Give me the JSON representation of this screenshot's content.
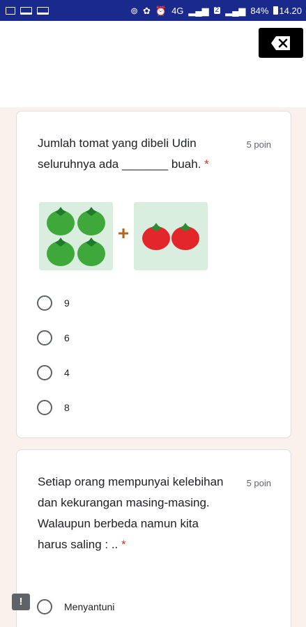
{
  "status_bar": {
    "battery": "84%",
    "time": "14.20",
    "network": "4G",
    "sim_badge": "2",
    "icons": [
      "image-icon",
      "screen-icon",
      "screen-icon",
      "location-icon",
      "sync-icon",
      "alarm-icon",
      "signal-icon",
      "signal-icon",
      "battery-icon"
    ]
  },
  "toolbar": {
    "close_icon": "close-x-icon"
  },
  "questions": [
    {
      "text": "Jumlah tomat yang dibeli Udin seluruhnya ada _______ buah.",
      "required_mark": "*",
      "points": "5 poin",
      "image": {
        "left_icon": "green-tomato-icon",
        "right_icon": "red-tomato-icon",
        "operator": "+",
        "green_count": 4,
        "red_count": 2
      },
      "options": [
        "9",
        "6",
        "4",
        "8"
      ]
    },
    {
      "text": "Setiap orang mempunyai kelebihan dan kekurangan masing-masing. Walaupun berbeda namun kita harus saling : ..",
      "required_mark": "*",
      "points": "5 poin",
      "options": [
        "Menyantuni"
      ]
    }
  ],
  "feedback": {
    "label": "!"
  },
  "colors": {
    "status_bar": "#1a2a8c",
    "page_background": "#faf1ec",
    "required": "#d93025",
    "image_background": "#d9eede",
    "green_tomato": "#3fa83a",
    "red_tomato": "#e3262b"
  }
}
